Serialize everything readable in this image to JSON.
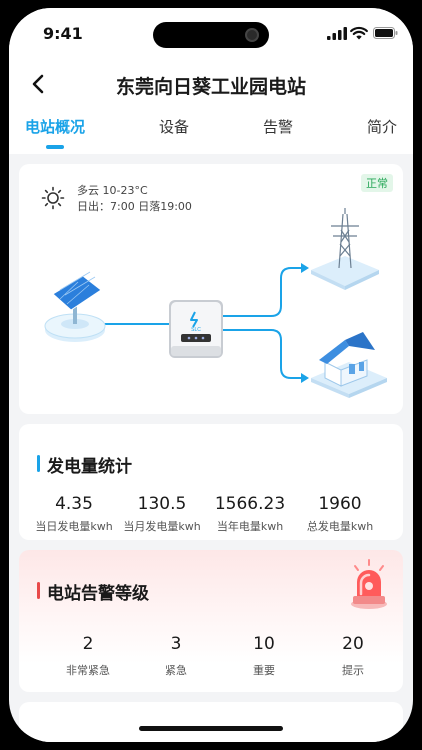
{
  "status_bar": {
    "time": "9:41"
  },
  "nav": {
    "title": "东莞向日葵工业园电站"
  },
  "tabs": [
    {
      "label": "电站概况",
      "active": true
    },
    {
      "label": "设备",
      "active": false
    },
    {
      "label": "告警",
      "active": false
    },
    {
      "label": "简介",
      "active": false
    }
  ],
  "overview": {
    "weather_icon": "sun-icon",
    "weather": "多云  10-23°C",
    "sun_times": "日出：7:00  日落19:00",
    "status_badge": "正常",
    "inverter_logo": "SLC"
  },
  "generation": {
    "title": "发电量统计",
    "items": [
      {
        "value": "4.35",
        "label": "当日发电量kwh"
      },
      {
        "value": "130.5",
        "label": "当月发电量kwh"
      },
      {
        "value": "1566.23",
        "label": "当年电量kwh"
      },
      {
        "value": "1960",
        "label": "总发电量kwh"
      }
    ]
  },
  "alarms": {
    "title": "电站告警等级",
    "items": [
      {
        "value": "2",
        "label": "非常紧急"
      },
      {
        "value": "3",
        "label": "紧急"
      },
      {
        "value": "10",
        "label": "重要"
      },
      {
        "value": "20",
        "label": "提示"
      }
    ]
  },
  "colors": {
    "accent": "#1aa3e8",
    "alarm": "#e84a4a",
    "ok": "#2aa85a"
  }
}
